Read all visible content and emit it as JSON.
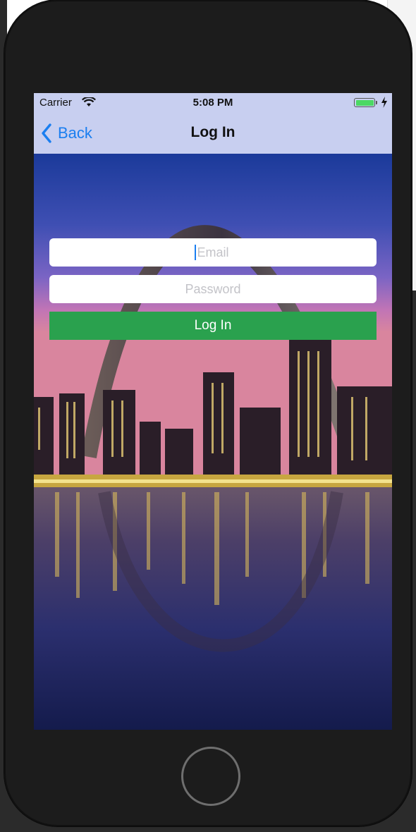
{
  "status_bar": {
    "carrier": "Carrier",
    "time": "5:08 PM",
    "battery_color": "#4cd964"
  },
  "nav_bar": {
    "back_label": "Back",
    "title": "Log In",
    "back_icon": "chevron-left-icon",
    "tint_color": "#1a7ef0",
    "background_color": "#c8cff0"
  },
  "form": {
    "email": {
      "value": "",
      "placeholder": "Email"
    },
    "password": {
      "value": "",
      "placeholder": "Password"
    },
    "login_button_label": "Log In",
    "login_button_color": "#2aa14e"
  },
  "background_image": {
    "semantic_name": "city-skyline-arch-photo"
  }
}
